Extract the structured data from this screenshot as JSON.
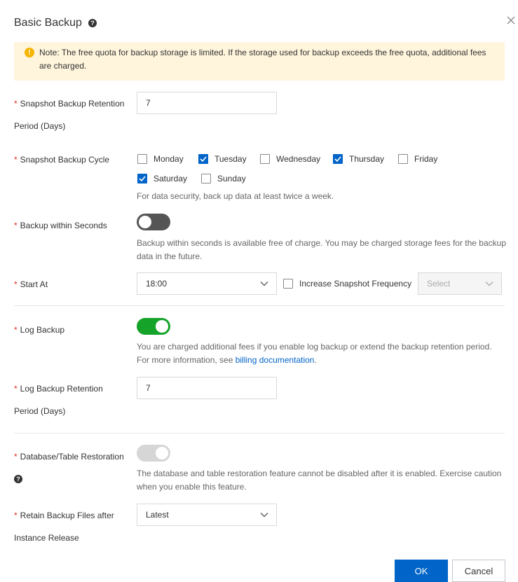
{
  "dialog": {
    "title": "Basic Backup",
    "note": "Note: The free quota for backup storage is limited. If the storage used for backup exceeds the free quota, additional fees are charged."
  },
  "snapshot_retention": {
    "label_line1": "Snapshot Backup Retention",
    "label_line2": "Period (Days)",
    "value": "7"
  },
  "snapshot_cycle": {
    "label": "Snapshot Backup Cycle",
    "days": [
      {
        "label": "Monday",
        "checked": false
      },
      {
        "label": "Tuesday",
        "checked": true
      },
      {
        "label": "Wednesday",
        "checked": false
      },
      {
        "label": "Thursday",
        "checked": true
      },
      {
        "label": "Friday",
        "checked": false
      },
      {
        "label": "Saturday",
        "checked": true
      },
      {
        "label": "Sunday",
        "checked": false
      }
    ],
    "hint": "For data security, back up data at least twice a week."
  },
  "backup_within_seconds": {
    "label": "Backup within Seconds",
    "enabled": false,
    "hint_line1": "Backup within seconds is available free of charge. You may be charged storage fees for the backup",
    "hint_line2": "data in the future."
  },
  "start_at": {
    "label": "Start At",
    "value": "18:00",
    "increase_label": "Increase Snapshot Frequency",
    "increase_checked": false,
    "frequency_placeholder": "Select"
  },
  "log_backup": {
    "label": "Log Backup",
    "enabled": true,
    "hint_line1": "You are charged additional fees if you enable log backup or extend the backup retention period.",
    "hint_line2_prefix": "For more information, see ",
    "hint_link": "billing documentation",
    "hint_line2_suffix": "."
  },
  "log_retention": {
    "label_line1": "Log Backup Retention",
    "label_line2": "Period (Days)",
    "value": "7"
  },
  "db_restoration": {
    "label": "Database/Table Restoration",
    "enabled": true,
    "disabled": true,
    "hint_line1": "The database and table restoration feature cannot be disabled after it is enabled. Exercise caution",
    "hint_line2": "when you enable this feature."
  },
  "retain_backup": {
    "label_line1": "Retain Backup Files after",
    "label_line2": "Instance Release",
    "value": "Latest"
  },
  "footer": {
    "ok_label": "OK",
    "cancel_label": "Cancel"
  },
  "colors": {
    "primary": "#0064c8",
    "toggle_on": "#15a32a",
    "toggle_off": "#555555",
    "toggle_disabled": "#d6d6d6",
    "required": "#d93026",
    "note_bg": "#fff4dc"
  },
  "icons": {
    "help": "question-circle-icon",
    "close": "close-icon",
    "warning": "warning-circle-icon",
    "dropdown": "chevron-down-icon",
    "check": "check-icon"
  }
}
